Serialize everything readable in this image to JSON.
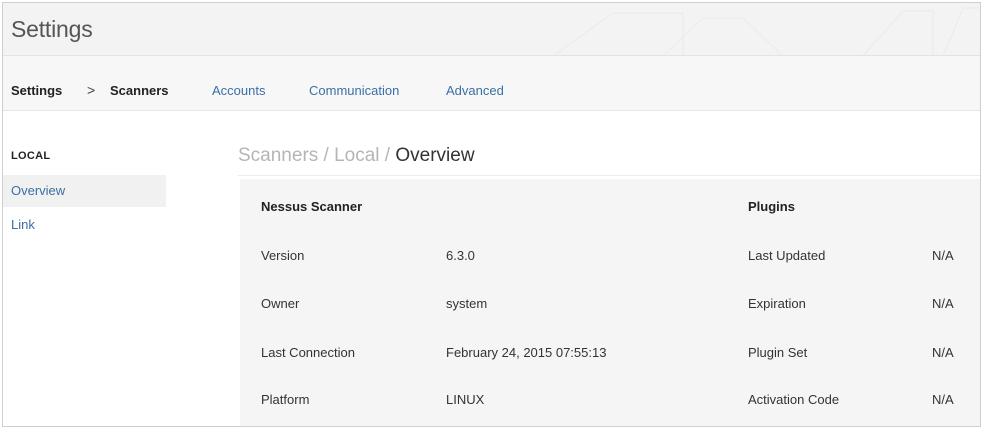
{
  "header": {
    "title": "Settings"
  },
  "nav": {
    "breadcrumb_root": "Settings",
    "separator": ">",
    "breadcrumb_current": "Scanners",
    "tabs": [
      "Accounts",
      "Communication",
      "Advanced"
    ]
  },
  "sidebar": {
    "section": "LOCAL",
    "items": [
      {
        "label": "Overview",
        "active": true
      },
      {
        "label": "Link",
        "active": false
      }
    ]
  },
  "content": {
    "breadcrumb_path": "Scanners / Local / ",
    "breadcrumb_current": "Overview",
    "scanner": {
      "heading": "Nessus Scanner",
      "rows": [
        {
          "label": "Version",
          "value": "6.3.0"
        },
        {
          "label": "Owner",
          "value": "system"
        },
        {
          "label": "Last Connection",
          "value": "February 24, 2015 07:55:13"
        },
        {
          "label": "Platform",
          "value": "LINUX"
        }
      ]
    },
    "plugins": {
      "heading": "Plugins",
      "rows": [
        {
          "label": "Last Updated",
          "value": "N/A"
        },
        {
          "label": "Expiration",
          "value": "N/A"
        },
        {
          "label": "Plugin Set",
          "value": "N/A"
        },
        {
          "label": "Activation Code",
          "value": "N/A"
        }
      ]
    }
  },
  "colors": {
    "link": "#3b6fa5",
    "header_bg": "#f3f3f3",
    "panel_bg": "#f5f5f5"
  }
}
